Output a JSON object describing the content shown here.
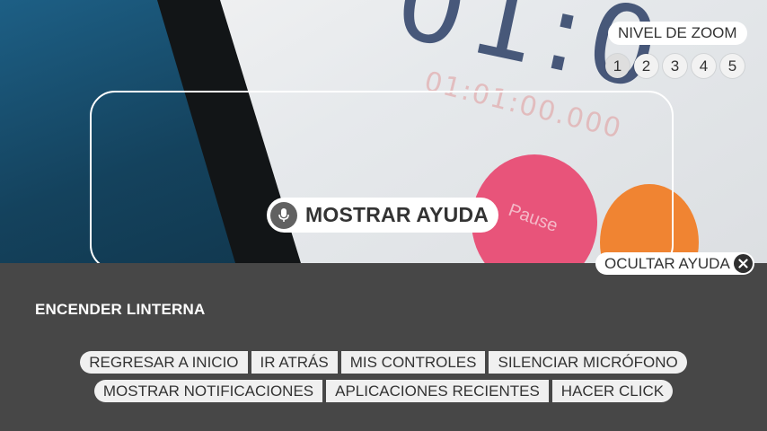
{
  "zoom": {
    "label": "NIVEL DE ZOOM",
    "levels": [
      "1",
      "2",
      "3",
      "4",
      "5"
    ],
    "current": "1"
  },
  "help": {
    "show_label": "MOSTRAR AYUDA",
    "hide_label": "OCULTAR AYUDA"
  },
  "flashlight": {
    "label": "ENCENDER LINTERNA"
  },
  "commands": {
    "row1": [
      "REGRESAR A INICIO",
      "IR ATRÁS",
      "MIS CONTROLES",
      "SILENCIAR MICRÓFONO"
    ],
    "row2": [
      "MOSTRAR NOTIFICACIONES",
      "APLICACIONES RECIENTES",
      "HACER CLICK"
    ]
  },
  "icons": {
    "mic": "microphone-icon",
    "close": "close-icon"
  },
  "colors": {
    "panel_bg": "#474747",
    "mic_bg": "#616161",
    "pill_bg": "#ffffff"
  }
}
